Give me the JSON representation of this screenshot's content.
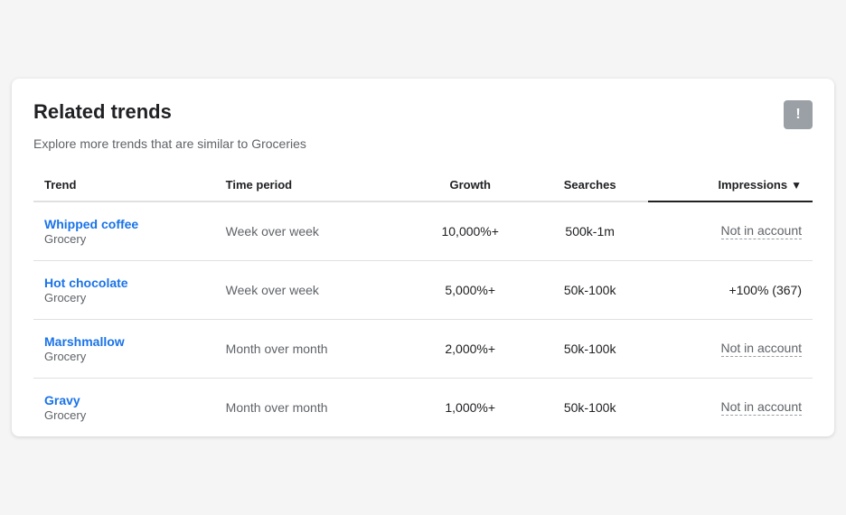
{
  "card": {
    "title": "Related trends",
    "subtitle": "Explore more trends that are similar to Groceries",
    "feedback_label": "!",
    "table": {
      "columns": [
        {
          "key": "trend",
          "label": "Trend",
          "align": "left"
        },
        {
          "key": "time_period",
          "label": "Time period",
          "align": "left"
        },
        {
          "key": "growth",
          "label": "Growth",
          "align": "center"
        },
        {
          "key": "searches",
          "label": "Searches",
          "align": "center"
        },
        {
          "key": "impressions",
          "label": "Impressions",
          "align": "right",
          "sorted": true
        }
      ],
      "rows": [
        {
          "trend_name": "Whipped coffee",
          "trend_category": "Grocery",
          "time_period": "Week over week",
          "growth": "10,000%+",
          "searches": "500k-1m",
          "impressions": "Not in account",
          "impressions_type": "not_in_account"
        },
        {
          "trend_name": "Hot chocolate",
          "trend_category": "Grocery",
          "time_period": "Week over week",
          "growth": "5,000%+",
          "searches": "50k-100k",
          "impressions": "+100% (367)",
          "impressions_type": "percent"
        },
        {
          "trend_name": "Marshmallow",
          "trend_category": "Grocery",
          "time_period": "Month over month",
          "growth": "2,000%+",
          "searches": "50k-100k",
          "impressions": "Not in account",
          "impressions_type": "not_in_account"
        },
        {
          "trend_name": "Gravy",
          "trend_category": "Grocery",
          "time_period": "Month over month",
          "growth": "1,000%+",
          "searches": "50k-100k",
          "impressions": "Not in account",
          "impressions_type": "not_in_account"
        }
      ]
    }
  }
}
